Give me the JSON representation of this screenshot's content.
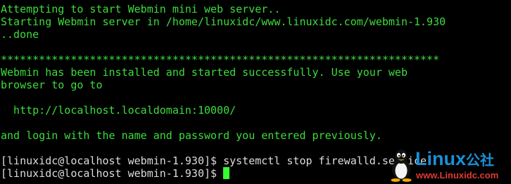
{
  "terminal": {
    "lines": [
      "Attempting to start Webmin mini web server..",
      "Starting Webmin server in /home/linuxidc/www.linuxidc.com/webmin-1.930",
      "..done",
      "",
      "*********************************************************************",
      "Webmin has been installed and started successfully. Use your web",
      "browser to go to",
      "",
      "  http://localhost.localdomain:10000/",
      "",
      "and login with the name and password you entered previously.",
      ""
    ],
    "prompt_lines": [
      "[linuxidc@localhost webmin-1.930]$ systemctl stop firewalld.service",
      "[linuxidc@localhost webmin-1.930]$ "
    ],
    "text_color": "#3cdc3c",
    "prompt_color": "#dcdcdc",
    "background": "#000000"
  },
  "watermark": {
    "brand": "Linux",
    "brand_cn": "公社",
    "url": "www.Linuxidc.com",
    "icon": "tux-penguin-icon",
    "brand_color": "#1a8fd6",
    "url_color": "#e03a2e"
  }
}
